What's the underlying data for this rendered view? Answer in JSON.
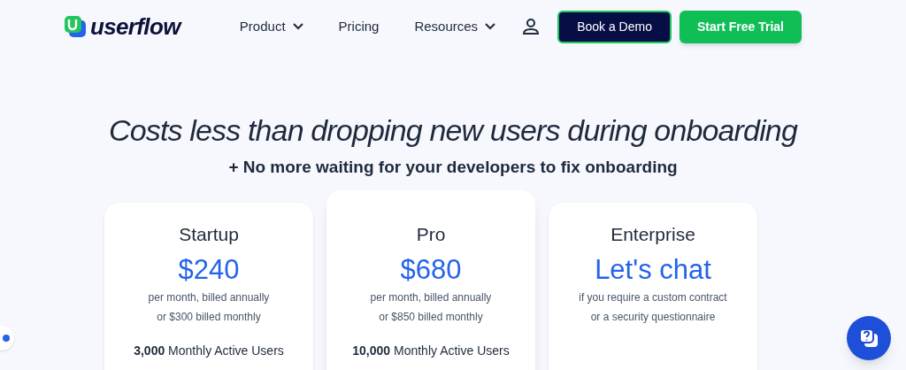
{
  "header": {
    "logo": "userflow",
    "nav": [
      {
        "label": "Product",
        "dropdown": true
      },
      {
        "label": "Pricing",
        "dropdown": false
      },
      {
        "label": "Resources",
        "dropdown": true
      }
    ],
    "buttons": [
      {
        "label": "Book a Demo",
        "kind": "dark"
      },
      {
        "label": "Start Free Trial",
        "kind": "green"
      }
    ]
  },
  "hero": {
    "title": "Costs less than dropping new users during onboarding",
    "subtitle": "+ No more waiting for your developers to fix onboarding"
  },
  "plans": [
    {
      "name": "Startup",
      "price": "$240",
      "notes": [
        "per month, billed annually",
        "or $300 billed monthly"
      ],
      "users": "**3,000** Monthly Active Users",
      "featured": false
    },
    {
      "name": "Pro",
      "price": "$680",
      "notes": [
        "per month, billed annually",
        "or $850 billed monthly"
      ],
      "users": "**10,000** Monthly Active Users",
      "featured": true
    },
    {
      "name": "Enterprise",
      "price": "Let's chat",
      "notes": [
        "if you require a custom contract",
        "or a security questionnaire"
      ],
      "featured": false
    }
  ]
}
